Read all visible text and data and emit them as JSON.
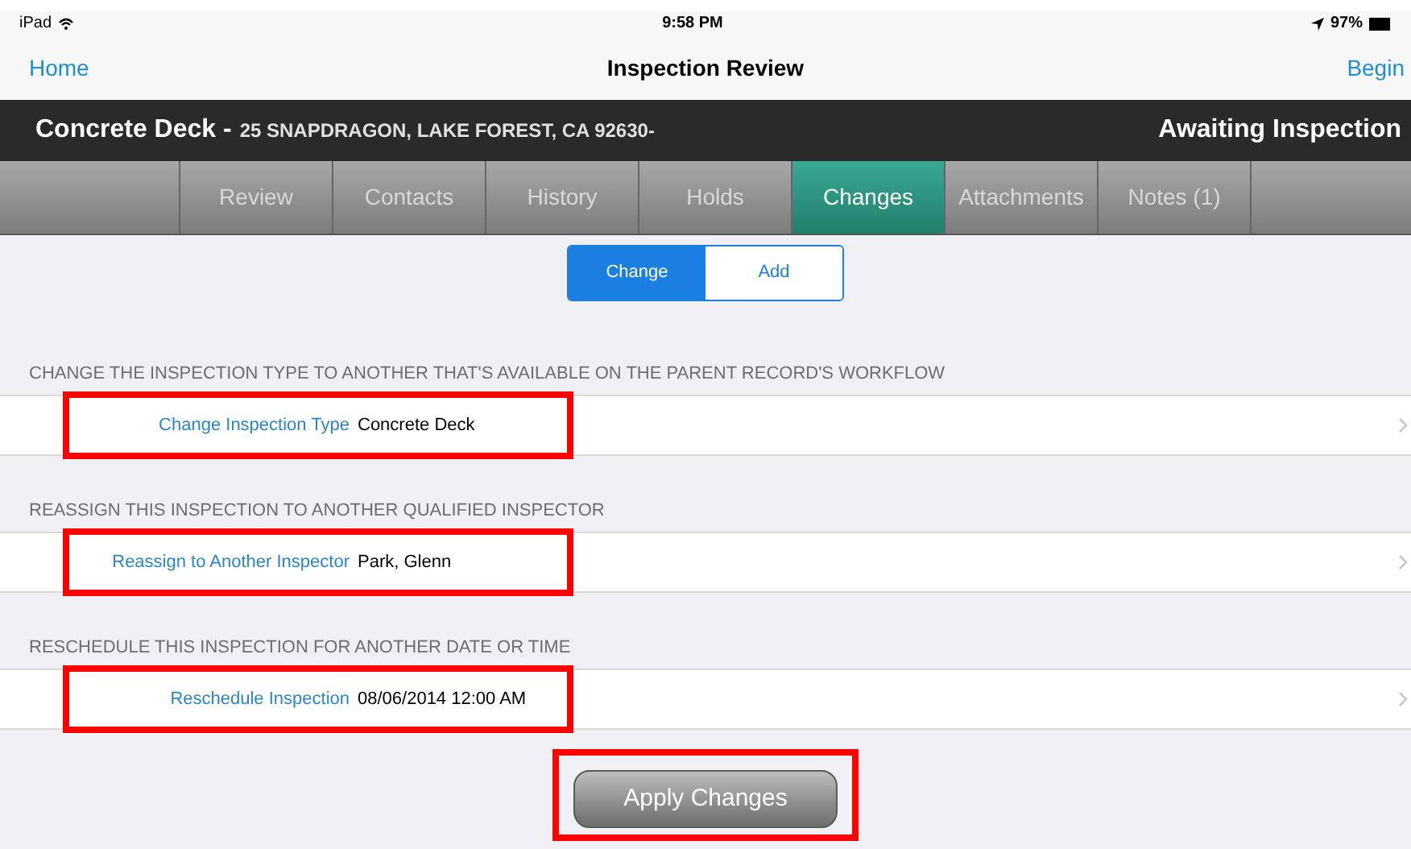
{
  "status_bar": {
    "device": "iPad",
    "time": "9:58 PM",
    "battery": "97%"
  },
  "nav_bar": {
    "left": "Home",
    "title": "Inspection Review",
    "right": "Begin"
  },
  "record_header": {
    "title": "Concrete Deck -",
    "address": "25 SNAPDRAGON, LAKE FOREST, CA 92630-",
    "status": "Awaiting Inspection"
  },
  "tabs": [
    {
      "label": "Review",
      "selected": false
    },
    {
      "label": "Contacts",
      "selected": false
    },
    {
      "label": "History",
      "selected": false
    },
    {
      "label": "Holds",
      "selected": false
    },
    {
      "label": "Changes",
      "selected": true
    },
    {
      "label": "Attachments",
      "selected": false
    },
    {
      "label": "Notes (1)",
      "selected": false
    }
  ],
  "segmented_control": [
    {
      "label": "Change",
      "selected": true
    },
    {
      "label": "Add",
      "selected": false
    }
  ],
  "sections": [
    {
      "header": "CHANGE THE INSPECTION TYPE TO ANOTHER THAT'S AVAILABLE ON THE PARENT RECORD'S WORKFLOW",
      "label": "Change Inspection Type",
      "value": "Concrete Deck",
      "highlighted": true
    },
    {
      "header": "REASSIGN THIS INSPECTION TO ANOTHER QUALIFIED INSPECTOR",
      "label": "Reassign to Another Inspector",
      "value": "Park, Glenn",
      "highlighted": true
    },
    {
      "header": "RESCHEDULE THIS INSPECTION FOR ANOTHER DATE OR TIME",
      "label": "Reschedule Inspection",
      "value": "08/06/2014 12:00 AM",
      "highlighted": true
    }
  ],
  "apply_button": {
    "label": "Apply Changes",
    "highlighted": true
  }
}
